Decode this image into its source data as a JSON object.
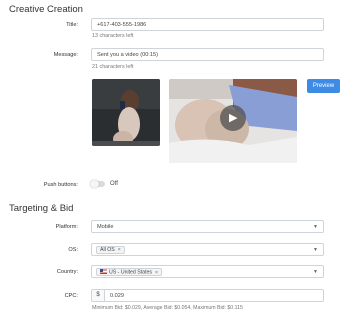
{
  "creative": {
    "section_title": "Creative Creation",
    "title_label": "Title:",
    "title_value": "+617-403-555-1986",
    "title_helper": "13 characters left",
    "message_label": "Message:",
    "message_value": "Sent you a video (00:15)",
    "message_helper": "21 characters left",
    "preview_label": "Preview",
    "push_label": "Push buttons:",
    "push_state": "Off"
  },
  "targeting": {
    "section_title": "Targeting & Bid",
    "platform_label": "Platform:",
    "platform_value": "Mobile",
    "os_label": "OS:",
    "os_chip": "All OS",
    "country_label": "Country:",
    "country_chip": "US - United States",
    "cpc_label": "CPC:",
    "cpc_prefix": "$",
    "cpc_value": "0.029",
    "bid_info": "Minimum Bid: $0.029, Average Bid: $0.054, Maximum Bid: $0.115"
  },
  "icons": {
    "remove": "×",
    "caret": "▼",
    "play": "▶"
  },
  "colors": {
    "accent": "#3d8be4",
    "border": "#cfd4da"
  }
}
